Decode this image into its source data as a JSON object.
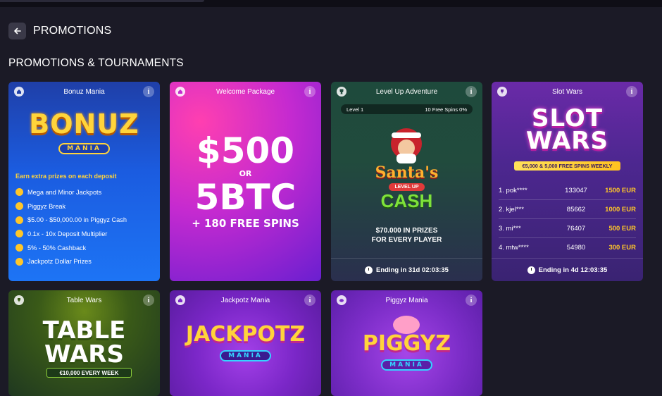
{
  "header": {
    "title": "PROMOTIONS"
  },
  "section": {
    "title": "PROMOTIONS & TOURNAMENTS"
  },
  "cards": {
    "bonuz": {
      "title": "Bonuz Mania",
      "logo_text": "BONUZ",
      "logo_ribbon": "MANIA",
      "earn": "Earn extra prizes on each deposit",
      "features": [
        "Mega and Minor Jackpots",
        "Piggyz Break",
        "$5.00 - $50,000.00 in Piggyz Cash",
        "0.1x - 10x Deposit Multiplier",
        "5% - 50% Cashback",
        "Jackpotz Dollar Prizes"
      ]
    },
    "welcome": {
      "title": "Welcome Package",
      "amount": "$500",
      "or": "OR",
      "btc": "5BTC",
      "spins": "+ 180 FREE SPINS"
    },
    "levelup": {
      "title": "Level Up Adventure",
      "level": "Level 1",
      "spins_progress": "10 Free Spins 0%",
      "game_title_1": "Santa's",
      "game_badge": "LEVEL UP",
      "game_title_2": "CASH",
      "prize_1": "$70.000 IN PRIZES",
      "prize_2": "FOR EVERY PLAYER",
      "ending": "Ending in 31d 02:03:35"
    },
    "slotwars": {
      "title": "Slot Wars",
      "logo_1": "SLOT",
      "logo_2": "WARS",
      "subtitle": "€5,000 & 5,000 FREE SPINS WEEKLY",
      "leaderboard": [
        {
          "rank_name": "1. pok****",
          "score": "133047",
          "prize": "1500 EUR"
        },
        {
          "rank_name": "2. kjel***",
          "score": "85662",
          "prize": "1000 EUR"
        },
        {
          "rank_name": "3. mi***",
          "score": "76407",
          "prize": "500 EUR"
        },
        {
          "rank_name": "4. mtw****",
          "score": "54980",
          "prize": "300 EUR"
        }
      ],
      "ending": "Ending in 4d 12:03:35"
    },
    "tablewars": {
      "title": "Table Wars",
      "logo_1": "TABLE",
      "logo_2": "WARS",
      "subtitle": "€10,000 EVERY WEEK"
    },
    "jackpotz": {
      "title": "Jackpotz Mania",
      "logo_text": "JACKPOTZ",
      "logo_ribbon": "MANIA"
    },
    "piggyz": {
      "title": "Piggyz Mania",
      "logo_text": "PIGGYZ",
      "logo_ribbon": "MANIA"
    }
  },
  "colors": {
    "background": "#1b1a26",
    "gold": "#ffc629"
  },
  "icons": {
    "back": "arrow-left-icon",
    "info": "info-icon",
    "home_badge": "house-icon",
    "trophy_badge": "trophy-icon",
    "clock": "clock-icon"
  }
}
